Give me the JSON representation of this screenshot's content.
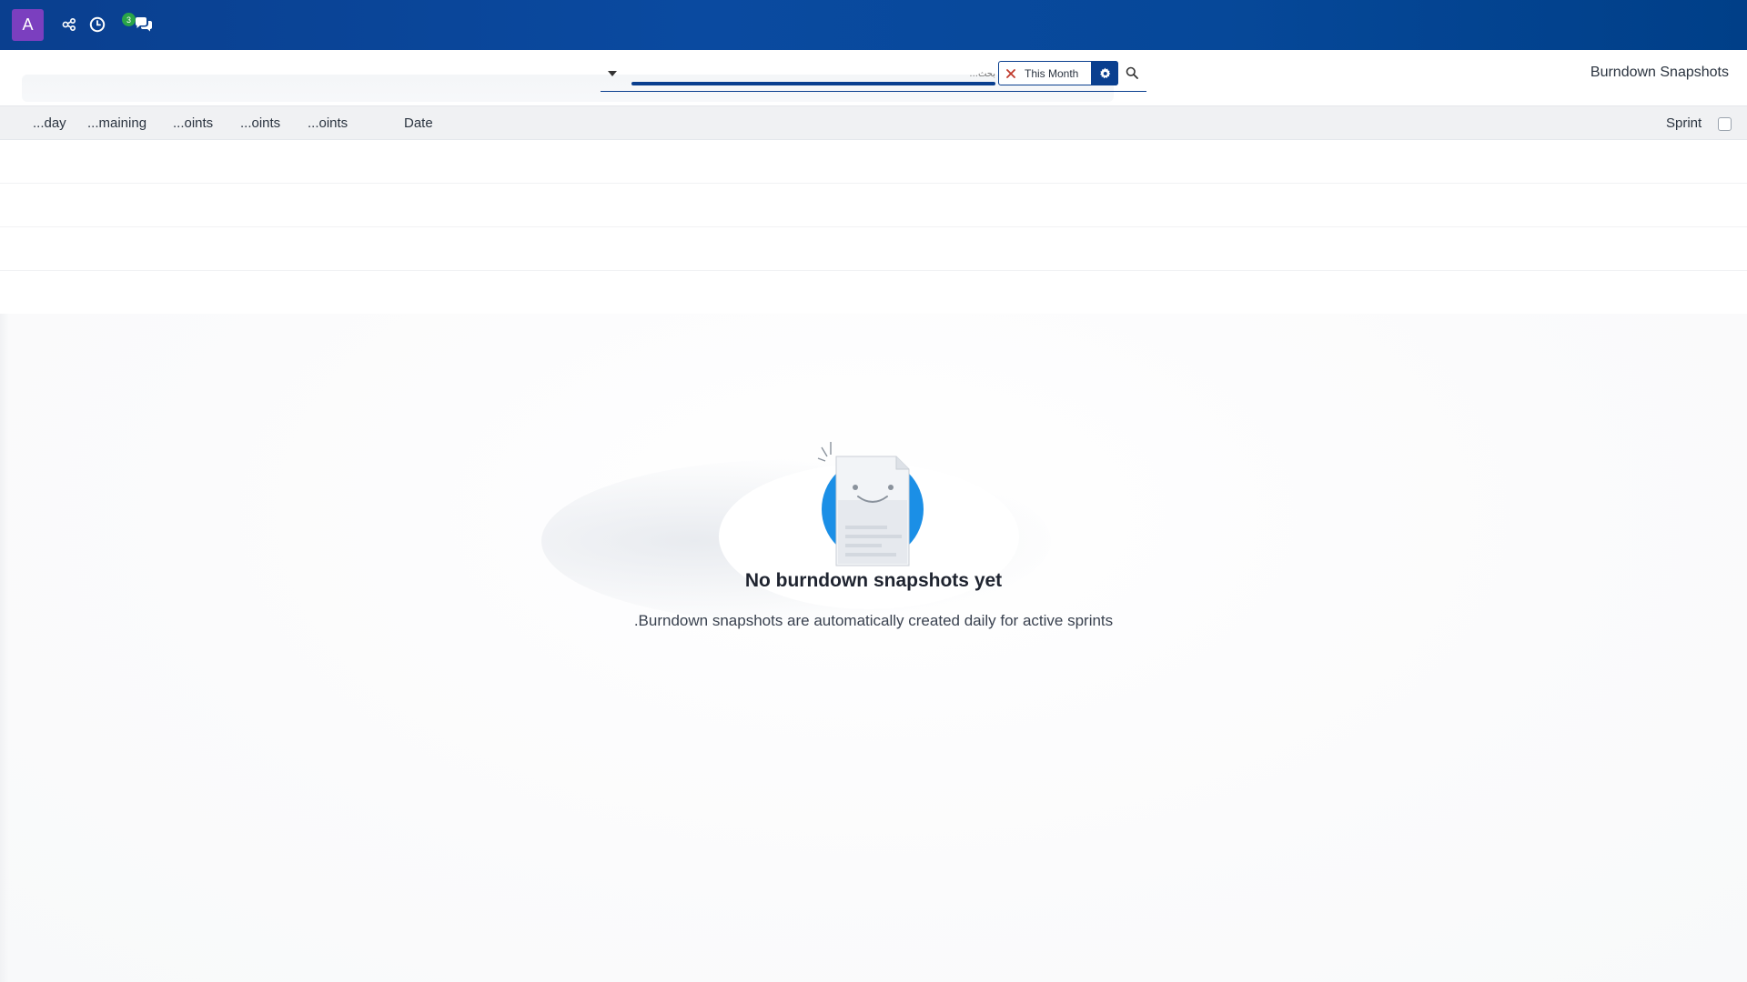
{
  "topbar": {
    "avatar_letter": "A",
    "icons": [
      "share-nodes-icon",
      "clock-icon",
      "comments-icon"
    ],
    "messages_badge": "3",
    "background_color": "#0a3f8f",
    "avatar_color": "#7b3fbf",
    "badge_color": "#2aa548"
  },
  "control_panel": {
    "page_title": "Burndown Snapshots",
    "search": {
      "placeholder": "...بحث",
      "value": ""
    },
    "facet": {
      "label": "This Month"
    }
  },
  "list": {
    "columns": [
      {
        "label": "...day"
      },
      {
        "label": "...maining"
      },
      {
        "label": "...oints"
      },
      {
        "label": "...oints"
      },
      {
        "label": "...oints"
      },
      {
        "label": "Date"
      },
      {
        "label": "Sprint"
      }
    ]
  },
  "empty_state": {
    "title": "No burndown snapshots yet",
    "subtitle": ".Burndown snapshots are automatically created daily for active sprints"
  }
}
